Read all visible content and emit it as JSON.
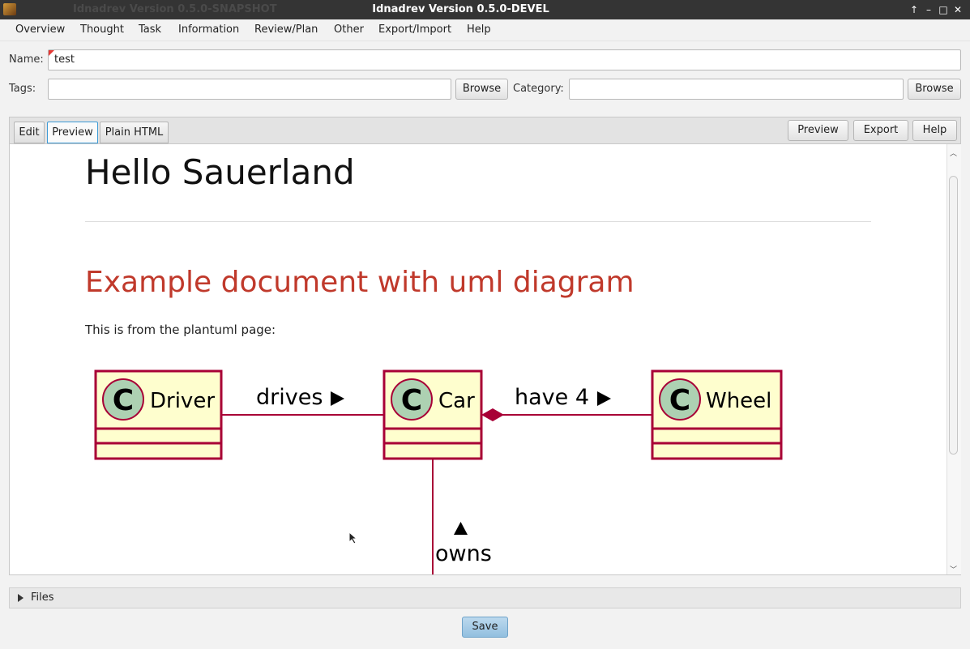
{
  "window": {
    "title": "Idnadrev Version 0.5.0-DEVEL",
    "ghost_title": "Idnadrev Version 0.5.0-SNAPSHOT",
    "controls": [
      "↑",
      "–",
      "□",
      "✕"
    ]
  },
  "menu": [
    "Overview",
    "Thought",
    "Task",
    "Information",
    "Review/Plan",
    "Other",
    "Export/Import",
    "Help"
  ],
  "form": {
    "name_label": "Name:",
    "name_value": "test",
    "tags_label": "Tags:",
    "tags_value": "",
    "tags_browse": "Browse",
    "category_label": "Category:",
    "category_value": "",
    "category_browse": "Browse"
  },
  "tabs": [
    "Edit",
    "Preview",
    "Plain HTML"
  ],
  "selected_tab": "Preview",
  "actions": [
    "Preview",
    "Export",
    "Help"
  ],
  "document": {
    "title": "Hello Sauerland",
    "subtitle": "Example document with uml diagram",
    "paragraph": "This is from the plantuml page:"
  },
  "diagram": {
    "stereotype": "C",
    "classes": [
      "Driver",
      "Car",
      "Wheel"
    ],
    "relations": [
      "drives",
      "have 4",
      "owns"
    ],
    "colors": {
      "class_fill": "#fefece",
      "border": "#a80036",
      "circle": "#add1b2"
    }
  },
  "files_label": "Files",
  "save_label": "Save"
}
